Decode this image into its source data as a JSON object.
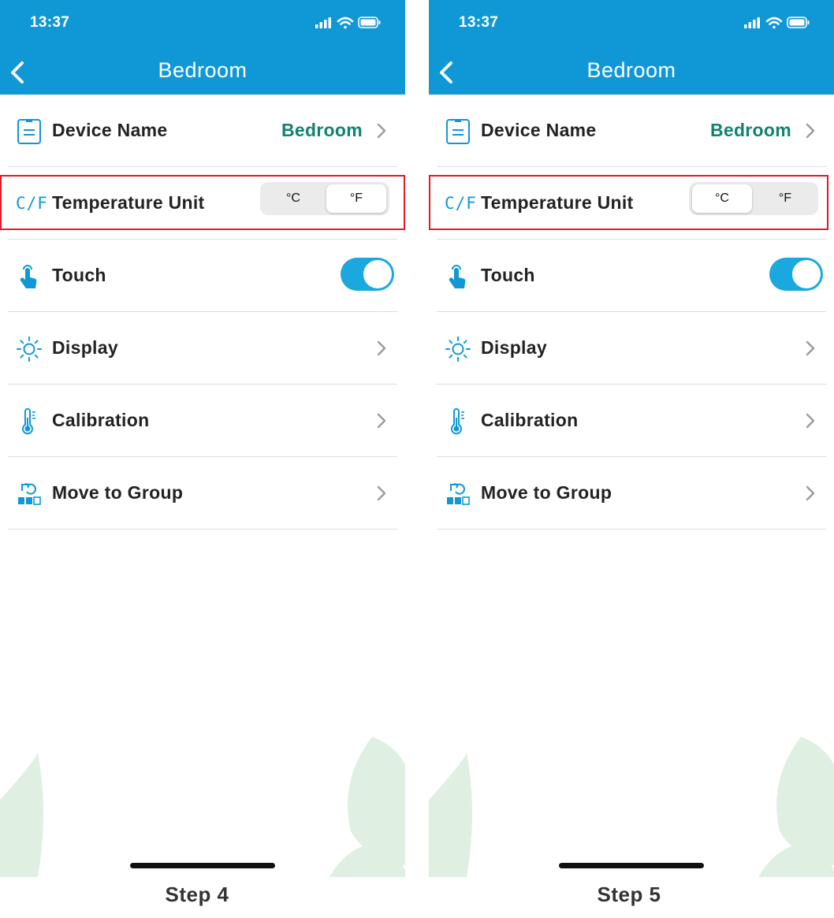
{
  "screens": [
    {
      "status_time": "13:37",
      "title": "Bedroom",
      "rows": {
        "device_name_label": "Device Name",
        "device_name_value": "Bedroom",
        "temp_unit_icon": "C/F",
        "temp_unit_label": "Temperature Unit",
        "unit_c": "°C",
        "unit_f": "°F",
        "selected_unit": "°F",
        "touch_label": "Touch",
        "touch_enabled": true,
        "display_label": "Display",
        "calibration_label": "Calibration",
        "move_group_label": "Move to Group"
      },
      "caption": "Step 4"
    },
    {
      "status_time": "13:37",
      "title": "Bedroom",
      "rows": {
        "device_name_label": "Device Name",
        "device_name_value": "Bedroom",
        "temp_unit_icon": "C/F",
        "temp_unit_label": "Temperature Unit",
        "unit_c": "°C",
        "unit_f": "°F",
        "selected_unit": "°C",
        "touch_label": "Touch",
        "touch_enabled": true,
        "display_label": "Display",
        "calibration_label": "Calibration",
        "move_group_label": "Move to Group"
      },
      "caption": "Step 5"
    }
  ],
  "colors": {
    "header": "#1098d6",
    "accent_value": "#138270",
    "toggle_on": "#1aa8df",
    "highlight_box": "#e01b22",
    "leaf": "#dff0e3"
  },
  "icons": [
    "back-chevron-icon",
    "signal-icon",
    "wifi-icon",
    "battery-icon",
    "document-icon",
    "touch-hand-icon",
    "sun-icon",
    "thermometer-icon",
    "move-group-icon",
    "chevron-right-icon",
    "leaf-decoration"
  ]
}
